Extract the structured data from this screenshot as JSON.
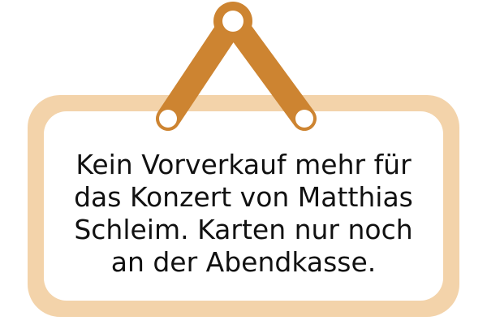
{
  "sign": {
    "message": "Kein Vorverkauf mehr für\ndas Konzert von Matthias\nSchleim. Karten nur noch\nan der Abendkasse."
  },
  "colors": {
    "board": "#f3d3aa",
    "panel": "#ffffff",
    "hanger": "#cd8431",
    "text": "#111111"
  },
  "icons": {
    "hanger": "sign-hanger-icon"
  }
}
